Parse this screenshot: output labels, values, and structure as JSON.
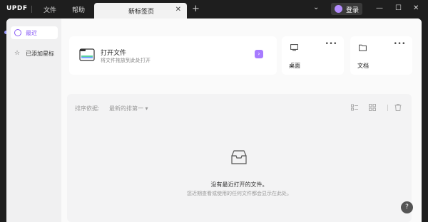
{
  "titlebar": {
    "logo": "UPDF",
    "menu": [
      "文件",
      "帮助"
    ],
    "tab_label": "新标签页",
    "tab_close": "✕",
    "add_tab": "+",
    "login_label": "登录",
    "chevron": "⌄",
    "minimize": "—",
    "maximize": "☐",
    "close": "✕"
  },
  "sidebar": {
    "items": [
      {
        "label": "最近",
        "icon": "clock-icon",
        "active": true
      },
      {
        "label": "已添加星标",
        "icon": "star-icon",
        "active": false
      }
    ]
  },
  "open_card": {
    "title": "打开文件",
    "subtitle": "将文件拖放到此处打开",
    "arrow": "›"
  },
  "location_cards": [
    {
      "label": "桌面",
      "icon": "desktop-icon",
      "menu": "•••"
    },
    {
      "label": "文档",
      "icon": "folder-icon",
      "menu": "•••"
    }
  ],
  "files": {
    "sort_label": "排序依据:",
    "sort_value": "最新的排第一 ▾",
    "empty_title": "没有最近打开的文件。",
    "empty_subtitle": "您近期查看或使用的任何文件都会显示在此处。"
  },
  "help": "?",
  "colors": {
    "accent": "#8a5cf6",
    "titlebar": "#1e1e1e"
  }
}
